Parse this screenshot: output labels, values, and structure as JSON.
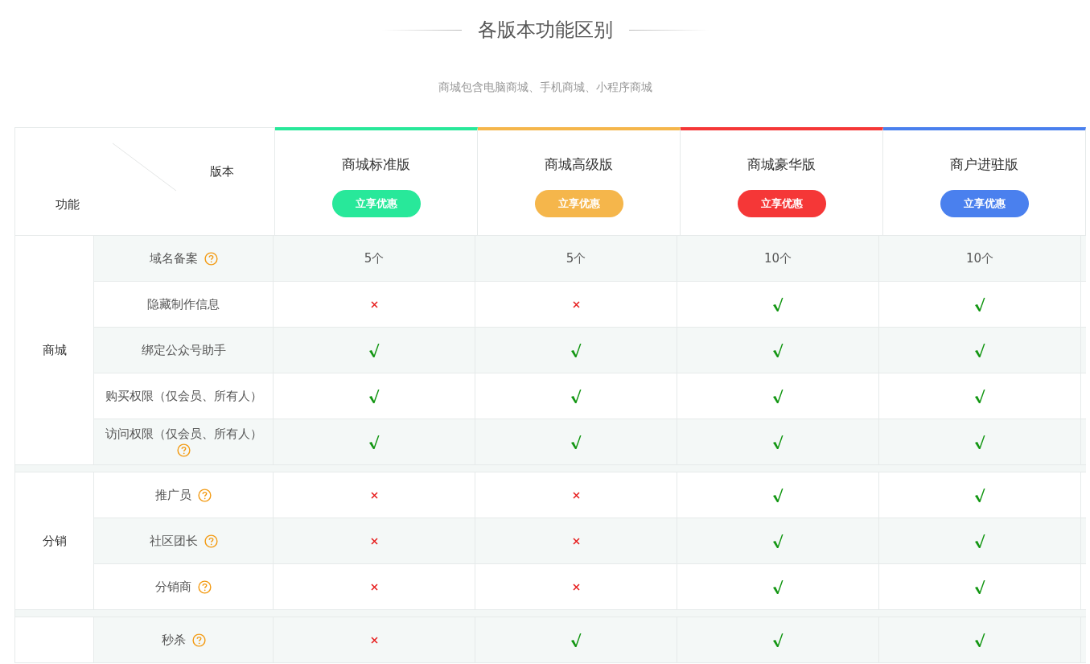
{
  "title": "各版本功能区别",
  "subtitle": "商城包含电脑商城、手机商城、小程序商城",
  "table": {
    "corner": {
      "column_label": "版本",
      "row_label": "功能"
    },
    "plans": [
      {
        "name": "商城标准版",
        "button": "立享优惠",
        "color": "#28e89a"
      },
      {
        "name": "商城高级版",
        "button": "立享优惠",
        "color": "#f5b64b"
      },
      {
        "name": "商城豪华版",
        "button": "立享优惠",
        "color": "#f53737"
      },
      {
        "name": "商户进驻版",
        "button": "立享优惠",
        "color": "#4a80ee"
      }
    ],
    "groups": [
      {
        "label": "商城",
        "rows": [
          {
            "feature": "域名备案",
            "help": true,
            "cells": [
              {
                "kind": "text",
                "text": "5个"
              },
              {
                "kind": "text",
                "text": "5个"
              },
              {
                "kind": "text",
                "text": "10个"
              },
              {
                "kind": "text",
                "text": "10个"
              }
            ]
          },
          {
            "feature": "隐藏制作信息",
            "help": false,
            "cells": [
              {
                "kind": "mark",
                "included": false
              },
              {
                "kind": "mark",
                "included": false
              },
              {
                "kind": "mark",
                "included": true
              },
              {
                "kind": "mark",
                "included": true
              }
            ]
          },
          {
            "feature": "绑定公众号助手",
            "help": false,
            "cells": [
              {
                "kind": "mark",
                "included": true
              },
              {
                "kind": "mark",
                "included": true
              },
              {
                "kind": "mark",
                "included": true
              },
              {
                "kind": "mark",
                "included": true
              }
            ]
          },
          {
            "feature": "购买权限（仅会员、所有人）",
            "help": false,
            "cells": [
              {
                "kind": "mark",
                "included": true
              },
              {
                "kind": "mark",
                "included": true
              },
              {
                "kind": "mark",
                "included": true
              },
              {
                "kind": "mark",
                "included": true
              }
            ]
          },
          {
            "feature": "访问权限（仅会员、所有人）",
            "help": true,
            "cells": [
              {
                "kind": "mark",
                "included": true
              },
              {
                "kind": "mark",
                "included": true
              },
              {
                "kind": "mark",
                "included": true
              },
              {
                "kind": "mark",
                "included": true
              }
            ]
          }
        ]
      },
      {
        "label": "分销",
        "rows": [
          {
            "feature": "推广员",
            "help": true,
            "cells": [
              {
                "kind": "mark",
                "included": false
              },
              {
                "kind": "mark",
                "included": false
              },
              {
                "kind": "mark",
                "included": true
              },
              {
                "kind": "mark",
                "included": true
              }
            ]
          },
          {
            "feature": "社区团长",
            "help": true,
            "cells": [
              {
                "kind": "mark",
                "included": false
              },
              {
                "kind": "mark",
                "included": false
              },
              {
                "kind": "mark",
                "included": true
              },
              {
                "kind": "mark",
                "included": true
              }
            ]
          },
          {
            "feature": "分销商",
            "help": true,
            "cells": [
              {
                "kind": "mark",
                "included": false
              },
              {
                "kind": "mark",
                "included": false
              },
              {
                "kind": "mark",
                "included": true
              },
              {
                "kind": "mark",
                "included": true
              }
            ]
          }
        ]
      },
      {
        "rows": [
          {
            "feature": "秒杀",
            "help": true,
            "cells": [
              {
                "kind": "mark",
                "included": false
              },
              {
                "kind": "mark",
                "included": true
              },
              {
                "kind": "mark",
                "included": true
              },
              {
                "kind": "mark",
                "included": true
              }
            ]
          }
        ]
      }
    ]
  }
}
